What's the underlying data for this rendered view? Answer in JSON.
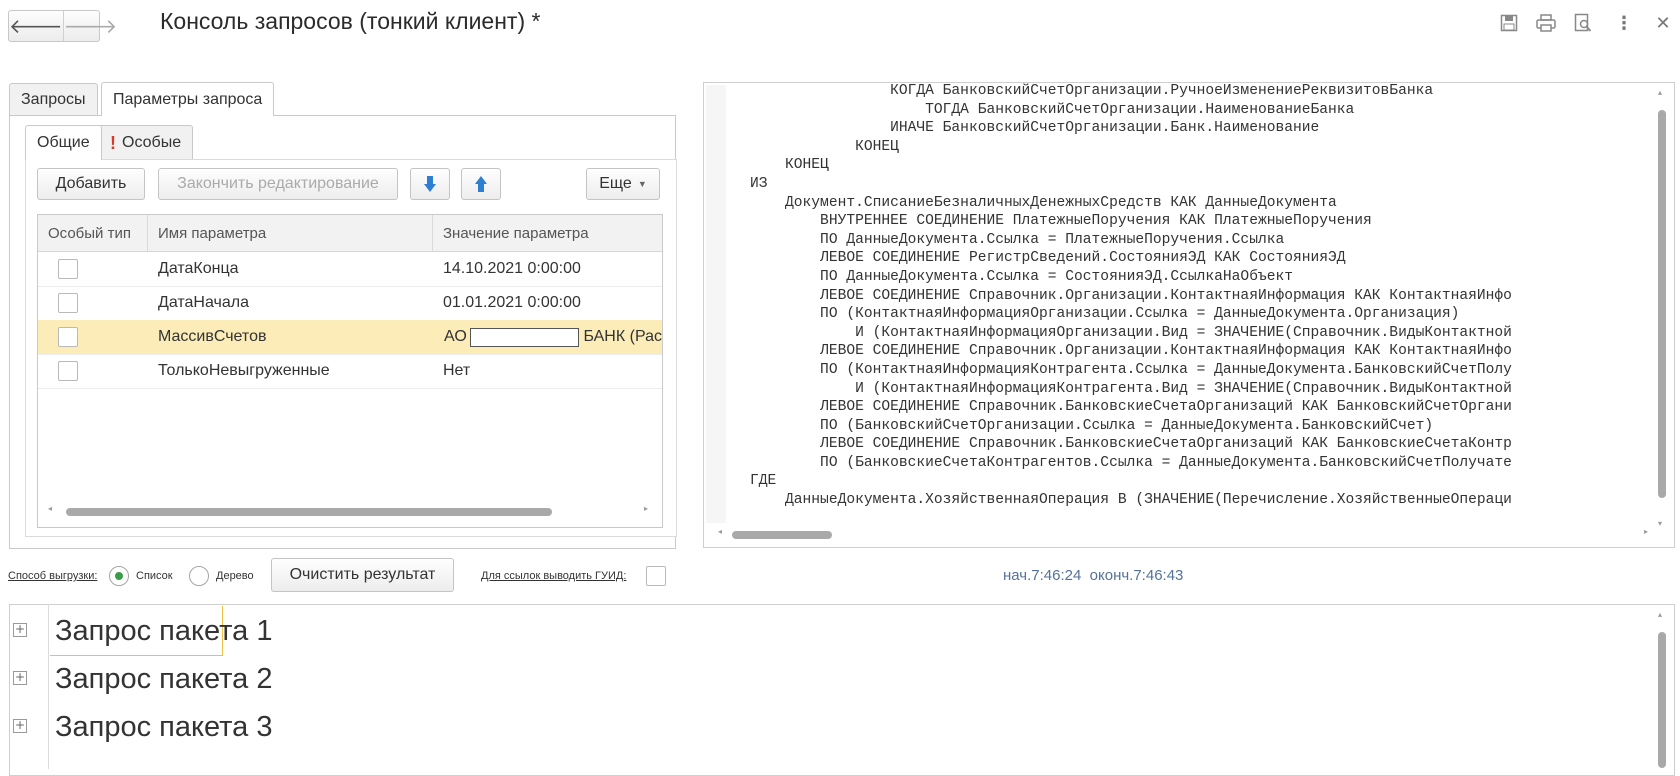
{
  "window": {
    "title": "Консоль запросов (тонкий клиент) *",
    "nav_back": "🡐",
    "nav_forward": "🡒"
  },
  "top_icons": [
    "save-icon",
    "print-icon",
    "preview-icon",
    "more-icon",
    "close-icon"
  ],
  "tabs": [
    {
      "label": "Запросы",
      "active": false
    },
    {
      "label": "Параметры запроса",
      "active": true
    }
  ],
  "subtabs": [
    {
      "label": "Общие",
      "active": true
    },
    {
      "label": "Особые",
      "active": false
    }
  ],
  "toolbar": {
    "add": "Добавить",
    "finish_edit": "Закончить редактирование",
    "more": "Еще"
  },
  "params_table": {
    "columns": [
      "Особый тип",
      "Имя параметра",
      "Значение параметра"
    ],
    "rows": [
      {
        "special": false,
        "name": "ДатаКонца",
        "value": "14.10.2021 0:00:00",
        "selected": false
      },
      {
        "special": false,
        "name": "ДатаНачала",
        "value": "01.01.2021 0:00:00",
        "selected": false
      },
      {
        "special": false,
        "name": "МассивСчетов",
        "value_prefix": "АО",
        "value_suffix": "БАНК (Рас",
        "selected": true
      },
      {
        "special": false,
        "name": "ТолькоНевыгруженные",
        "value": "Нет",
        "selected": false
      }
    ]
  },
  "query_text": [
    "                КОГДА БанковскийСчетОрганизации.РучноеИзменениеРеквизитовБанка",
    "                    ТОГДА БанковскийСчетОрганизации.НаименованиеБанка",
    "                ИНАЧЕ БанковскийСчетОрганизации.Банк.Наименование",
    "            КОНЕЦ",
    "    КОНЕЦ",
    "ИЗ",
    "    Документ.СписаниеБезналичныхДенежныхСредств КАК ДанныеДокумента",
    "        ВНУТРЕННЕЕ СОЕДИНЕНИЕ ПлатежныеПоручения КАК ПлатежныеПоручения",
    "        ПО ДанныеДокумента.Ссылка = ПлатежныеПоручения.Ссылка",
    "        ЛЕВОЕ СОЕДИНЕНИЕ РегистрСведений.СостоянияЭД КАК СостоянияЭД",
    "        ПО ДанныеДокумента.Ссылка = СостоянияЭД.СсылкаНаОбъект",
    "        ЛЕВОЕ СОЕДИНЕНИЕ Справочник.Организации.КонтактнаяИнформация КАК КонтактнаяИнфо",
    "        ПО (КонтактнаяИнформацияОрганизации.Ссылка = ДанныеДокумента.Организация)",
    "            И (КонтактнаяИнформацияОрганизации.Вид = ЗНАЧЕНИЕ(Справочник.ВидыКонтактной",
    "        ЛЕВОЕ СОЕДИНЕНИЕ Справочник.Организации.КонтактнаяИнформация КАК КонтактнаяИнфо",
    "        ПО (КонтактнаяИнформацияКонтрагента.Ссылка = ДанныеДокумента.БанковскийСчетПолу",
    "            И (КонтактнаяИнформацияКонтрагента.Вид = ЗНАЧЕНИЕ(Справочник.ВидыКонтактной",
    "        ЛЕВОЕ СОЕДИНЕНИЕ Справочник.БанковскиеСчетаОрганизаций КАК БанковскийСчетОргани",
    "        ПО (БанковскийСчетОрганизации.Ссылка = ДанныеДокумента.БанковскийСчет)",
    "        ЛЕВОЕ СОЕДИНЕНИЕ Справочник.БанковскиеСчетаОрганизаций КАК БанковскиеСчетаКонтр",
    "        ПО (БанковскиеСчетаКонтрагентов.Ссылка = ДанныеДокумента.БанковскийСчетПолучате",
    "ГДЕ",
    "    ДанныеДокумента.ХозяйственнаяОперация В (ЗНАЧЕНИЕ(Перечисление.ХозяйственныеОпераци"
  ],
  "export_bar": {
    "mode_label": "Способ выгрузки:",
    "mode_list": "Список",
    "mode_tree": "Дерево",
    "selected_mode": "Список",
    "clear_button": "Очистить результат",
    "guid_label": "Для ссылок выводить ГУИД:",
    "timing": "нач.7:46:24  оконч.7:46:43"
  },
  "results": [
    {
      "label": "Запрос пакета 1"
    },
    {
      "label": "Запрос пакета 2"
    },
    {
      "label": "Запрос пакета 3"
    }
  ]
}
